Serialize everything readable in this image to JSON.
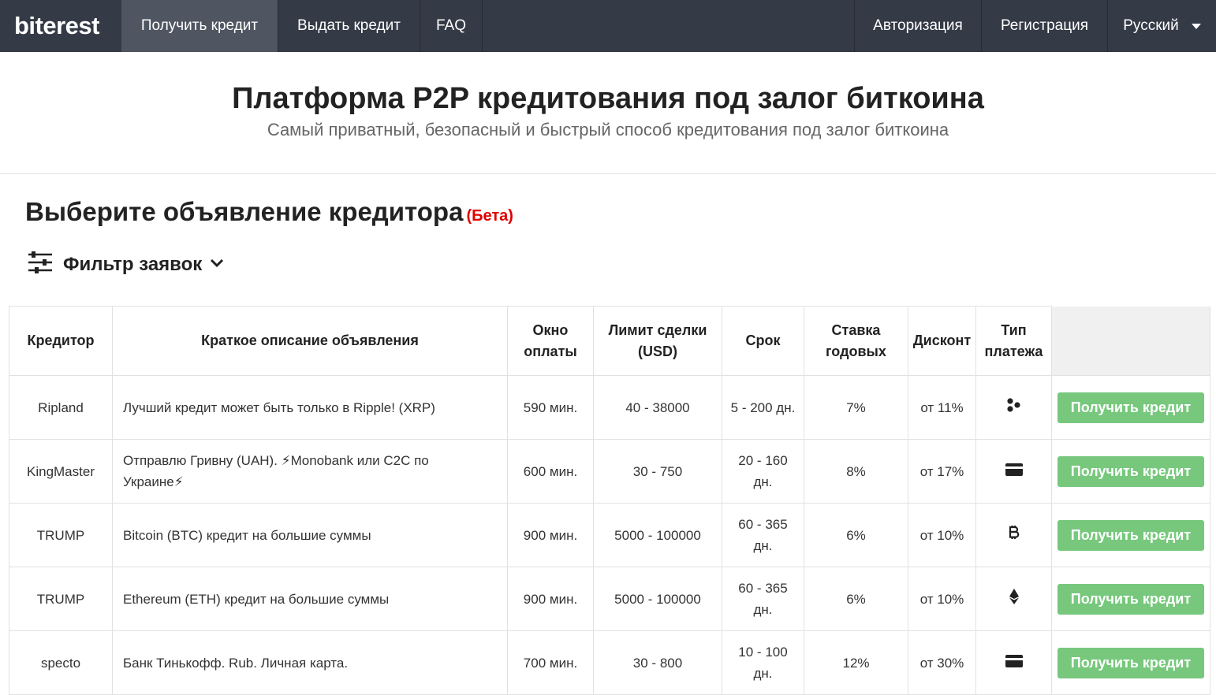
{
  "nav": {
    "brand": "biterest",
    "left": [
      "Получить кредит",
      "Выдать кредит",
      "FAQ"
    ],
    "right": [
      "Авторизация",
      "Регистрация",
      "Русский"
    ]
  },
  "hero": {
    "title": "Платформа P2P кредитования под залог биткоина",
    "subtitle": "Самый приватный, безопасный и быстрый способ кредитования под залог биткоина"
  },
  "section": {
    "title": "Выберите объявление кредитора",
    "beta": "(Бета)",
    "filter_label": "Фильтр заявок"
  },
  "table": {
    "headers": {
      "lender": "Кредитор",
      "desc": "Краткое описание объявления",
      "window": "Окно оплаты",
      "limit": "Лимит сделки (USD)",
      "term": "Срок",
      "rate": "Ставка годовых",
      "discount": "Дисконт",
      "payment": "Тип платежа"
    },
    "button_label": "Получить кредит",
    "rows": [
      {
        "lender": "Ripland",
        "desc": "Лучший кредит может быть только в Ripple! (XRP)",
        "window": "590 мин.",
        "limit": "40 - 38000",
        "term": "5 - 200 дн.",
        "rate": "7%",
        "discount": "от 11%",
        "payment_icon": "xrp-icon"
      },
      {
        "lender": "KingMaster",
        "desc": "Отправлю Гривну (UAH). ⚡Monobank или C2C по Украине⚡",
        "window": "600 мин.",
        "limit": "30 - 750",
        "term": "20 - 160 дн.",
        "rate": "8%",
        "discount": "от 17%",
        "payment_icon": "card-icon"
      },
      {
        "lender": "TRUMP",
        "desc": "Bitcoin (BTC) кредит на большие суммы",
        "window": "900 мин.",
        "limit": "5000 - 100000",
        "term": "60 - 365 дн.",
        "rate": "6%",
        "discount": "от 10%",
        "payment_icon": "bitcoin-icon"
      },
      {
        "lender": "TRUMP",
        "desc": "Ethereum (ETH) кредит на большие суммы",
        "window": "900 мин.",
        "limit": "5000 - 100000",
        "term": "60 - 365 дн.",
        "rate": "6%",
        "discount": "от 10%",
        "payment_icon": "ethereum-icon"
      },
      {
        "lender": "specto",
        "desc": "Банк Тинькофф. Rub. Личная карта.",
        "window": "700 мин.",
        "limit": "30 - 800",
        "term": "10 - 100 дн.",
        "rate": "12%",
        "discount": "от 30%",
        "payment_icon": "card-icon"
      }
    ]
  }
}
